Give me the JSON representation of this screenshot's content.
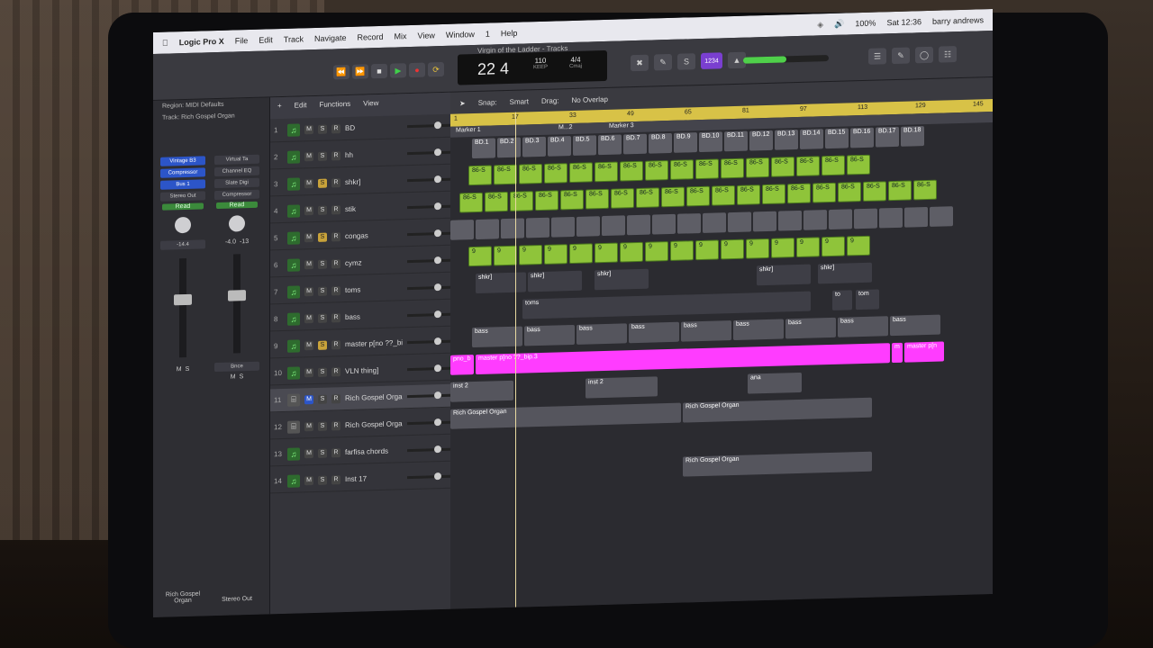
{
  "menubar": {
    "app": "Logic Pro X",
    "items": [
      "File",
      "Edit",
      "Track",
      "Navigate",
      "Record",
      "Mix",
      "View",
      "Window",
      "1",
      "Help"
    ],
    "battery": "100%",
    "time": "Sat 12:36",
    "user": "barry andrews"
  },
  "control": {
    "doc_title": "Virgin of the Ladder - Tracks",
    "position": "22  4",
    "tempo": "110",
    "tempo_label": "KEEP",
    "signature": "4/4",
    "key": "Cmaj",
    "count_in": "1234",
    "volume_level": 0.5
  },
  "inspector": {
    "region_label": "Region:",
    "region_value": "MIDI Defaults",
    "track_label": "Track:",
    "track_value": "Rich Gospel Organ",
    "strip_a": {
      "plugin": "Vintage B3",
      "plugin2": "Compressor",
      "bus": "Bus 1",
      "output": "Stereo Out",
      "read": "Read",
      "vol": "-14.4",
      "name": "Rich Gospel Organ"
    },
    "strip_b": {
      "plugins": [
        "Virtual Ta",
        "Channel EQ",
        "Slate Digi",
        "Compressor"
      ],
      "read": "Read",
      "vol": "-4.0",
      "vol2": "-13",
      "bounce": "Bnce",
      "name": "Stereo Out"
    }
  },
  "arrange_header": {
    "edit": "Edit",
    "functions": "Functions",
    "view": "View",
    "snap_label": "Snap:",
    "snap_value": "Smart",
    "drag_label": "Drag:",
    "drag_value": "No Overlap"
  },
  "ruler": [
    "1",
    "17",
    "33",
    "49",
    "65",
    "81",
    "97",
    "113",
    "129",
    "145"
  ],
  "markers": [
    "Marker 1",
    "M...2",
    "Marker 3"
  ],
  "beat_labels": [
    "BD.1",
    "BD.2",
    "BD.3",
    "BD.4",
    "BD.5",
    "BD.6",
    "BD.7",
    "BD.8",
    "BD.9",
    "BD.10",
    "BD.11",
    "BD.12",
    "BD.13",
    "BD.14",
    "BD.15",
    "BD.16",
    "BD.17",
    "BD.18"
  ],
  "tracks": [
    {
      "num": "1",
      "name": "BD",
      "type": "midi"
    },
    {
      "num": "2",
      "name": "hh",
      "type": "midi"
    },
    {
      "num": "3",
      "name": "shkr]",
      "type": "midi"
    },
    {
      "num": "4",
      "name": "stik",
      "type": "midi"
    },
    {
      "num": "5",
      "name": "congas",
      "type": "midi"
    },
    {
      "num": "6",
      "name": "cymz",
      "type": "midi"
    },
    {
      "num": "7",
      "name": "toms",
      "type": "midi"
    },
    {
      "num": "8",
      "name": "bass",
      "type": "midi"
    },
    {
      "num": "9",
      "name": "master p[no ??_bip",
      "type": "midi"
    },
    {
      "num": "10",
      "name": "VLN thing]",
      "type": "midi"
    },
    {
      "num": "11",
      "name": "Rich Gospel Organ",
      "type": "organ"
    },
    {
      "num": "12",
      "name": "Rich Gospel Organ",
      "type": "organ"
    },
    {
      "num": "13",
      "name": "farfisa chords",
      "type": "midi"
    },
    {
      "num": "14",
      "name": "Inst 17",
      "type": "midi"
    }
  ],
  "regions": {
    "r86": "86-S",
    "r9": "9",
    "shkr": "shkr]",
    "toms": "toms",
    "to": "to",
    "tom": "tom",
    "bass": "bass",
    "pno": "pno_b",
    "master": "master p[no ??_bip.3",
    "m": "m",
    "master_short": "master p[n",
    "inst2": "inst 2",
    "ana": "ana",
    "organ": "Rich Gospel Organ"
  }
}
